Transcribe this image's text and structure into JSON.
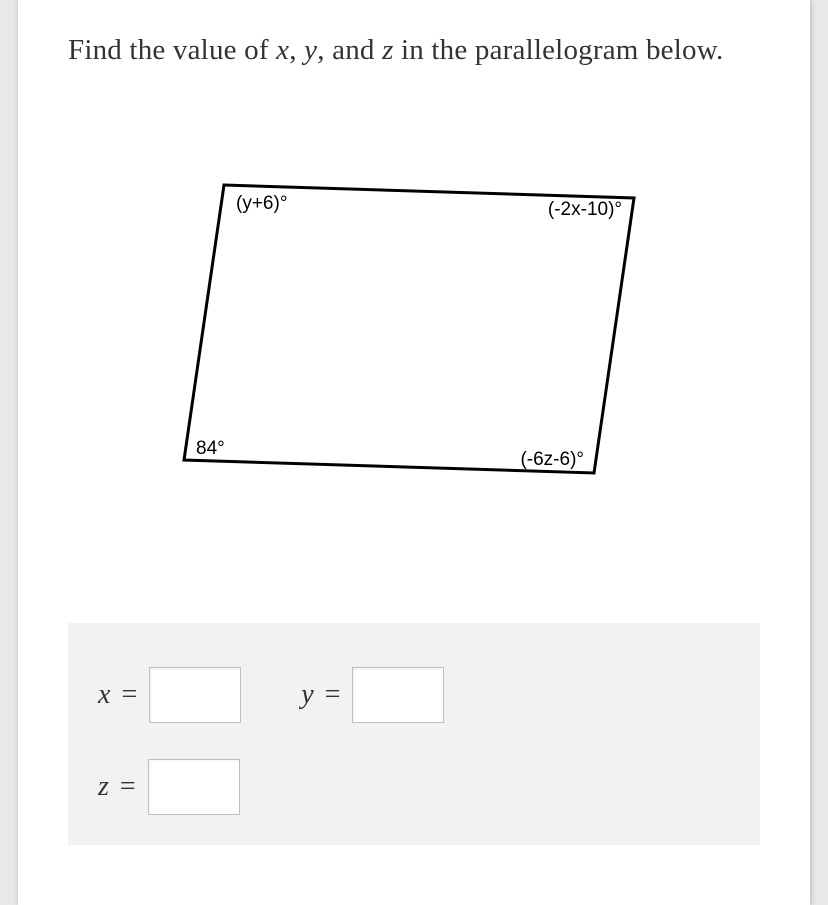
{
  "question": {
    "pre": "Find the value of ",
    "v1": "x",
    "sep1": ", ",
    "v2": "y",
    "sep2": ", and ",
    "v3": "z",
    "post": " in the parallelogram below."
  },
  "parallelogram": {
    "top_left_label": "(y+6)°",
    "top_right_label": "(-2x-10)°",
    "bottom_left_label": "84°",
    "bottom_right_label": "(-6z-6)°"
  },
  "answers": {
    "x_label": "x =",
    "y_label": "y =",
    "z_label": "z =",
    "x_value": "",
    "y_value": "",
    "z_value": ""
  }
}
